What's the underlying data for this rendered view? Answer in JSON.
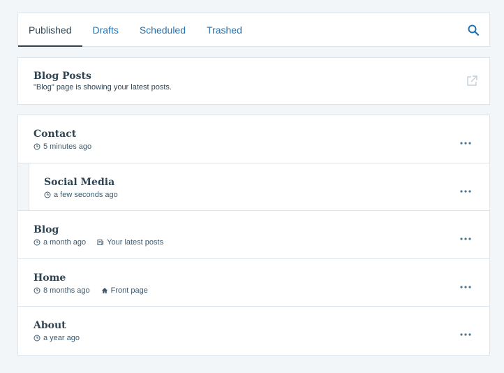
{
  "tabs": [
    {
      "label": "Published",
      "active": true
    },
    {
      "label": "Drafts",
      "active": false
    },
    {
      "label": "Scheduled",
      "active": false
    },
    {
      "label": "Trashed",
      "active": false
    }
  ],
  "search": {
    "icon": "search-icon"
  },
  "blog_card": {
    "title": "Blog Posts",
    "description": "\"Blog\" page is showing your latest posts.",
    "icon": "external-link-icon"
  },
  "pages": [
    {
      "title": "Contact",
      "time": "5 minutes ago",
      "extra": null
    },
    {
      "title": "Social Media",
      "time": "a few seconds ago",
      "extra": null,
      "child": true
    },
    {
      "title": "Blog",
      "time": "a month ago",
      "extra": "Your latest posts",
      "extra_icon": "posts-icon"
    },
    {
      "title": "Home",
      "time": "8 months ago",
      "extra": "Front page",
      "extra_icon": "home-icon"
    },
    {
      "title": "About",
      "time": "a year ago",
      "extra": null
    }
  ],
  "colors": {
    "accent": "#2271b1",
    "text": "#2e4453",
    "border": "#dde5ec",
    "background": "#f3f6f8"
  }
}
